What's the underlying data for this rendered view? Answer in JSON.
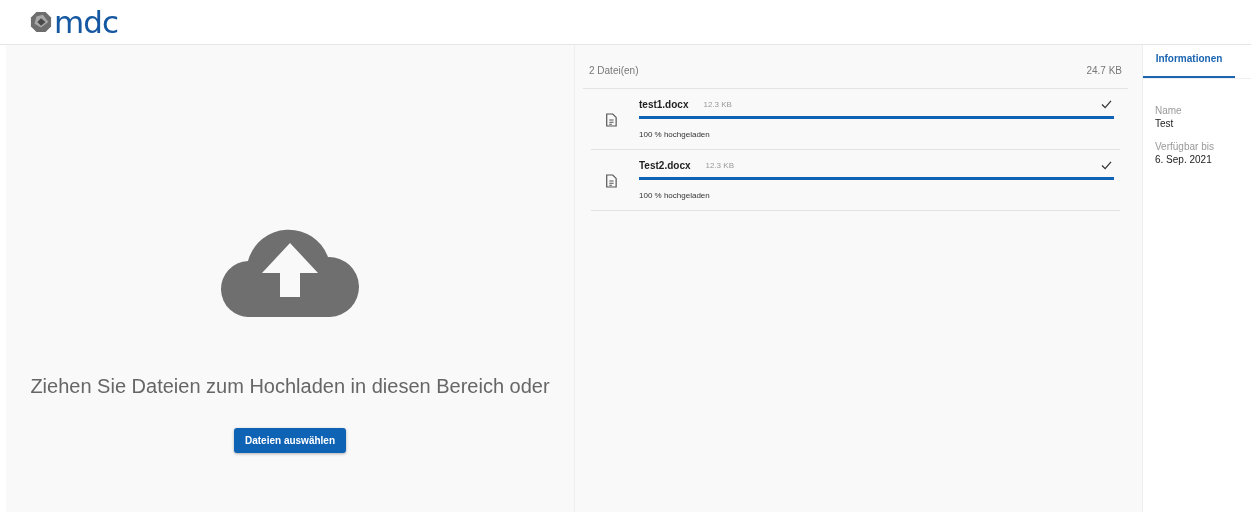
{
  "logo": {
    "text": "mdc"
  },
  "dropzone": {
    "message": "Ziehen Sie Dateien zum Hochladen in diesen Bereich oder",
    "button": "Dateien auswählen"
  },
  "files": {
    "count": "2 Datei(en)",
    "total": "24.7 KB",
    "items": [
      {
        "name": "test1.docx",
        "size": "12.3 KB",
        "level": 1,
        "status": "100 % hochgeladen",
        "done": true
      },
      {
        "name": "Test2.docx",
        "size": "12.3 KB",
        "level": 1,
        "status": "100 % hochgeladen",
        "done": true
      }
    ]
  },
  "sidebar": {
    "tabs": [
      {
        "label": "Informationen",
        "selected": true
      }
    ],
    "fields": [
      {
        "label": "Name",
        "value": "Test"
      },
      {
        "label": "Verfügbar bis",
        "value": "6. Sep. 2021"
      }
    ]
  }
}
